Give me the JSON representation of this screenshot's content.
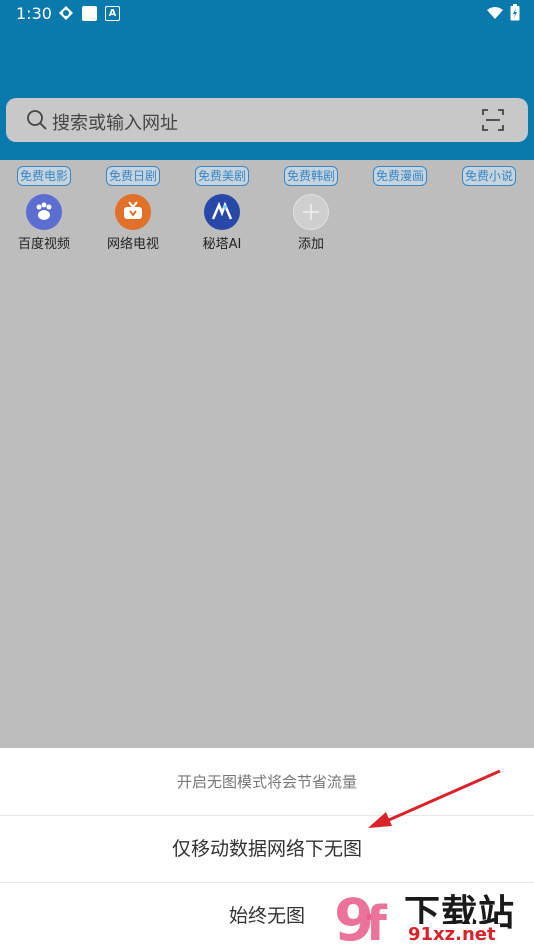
{
  "status": {
    "time": "1:30"
  },
  "search": {
    "placeholder": "搜索或输入网址"
  },
  "tags": [
    "免费电影",
    "免费日剧",
    "免费美剧",
    "免费韩剧",
    "免费漫画",
    "免费小说"
  ],
  "apps": [
    {
      "label": "百度视频",
      "color": "#5c6fd1",
      "icon": "baidu-paw-icon"
    },
    {
      "label": "网络电视",
      "color": "#e0702a",
      "icon": "tv-icon"
    },
    {
      "label": "秘塔AI",
      "color": "#2848a8",
      "icon": "metaso-ai-icon"
    },
    {
      "label": "添加",
      "color": "#d0d0d0",
      "icon": "add-icon"
    }
  ],
  "sheet": {
    "hint": "开启无图模式将会节省流量",
    "option_mobile": "仅移动数据网络下无图",
    "option_always": "始终无图"
  },
  "watermark": {
    "title": "下载站",
    "url": "91xz.net",
    "logo": "9f"
  },
  "colors": {
    "header": "#0a79ab",
    "tag": "#3a86c4",
    "arrow": "#d9232a"
  }
}
